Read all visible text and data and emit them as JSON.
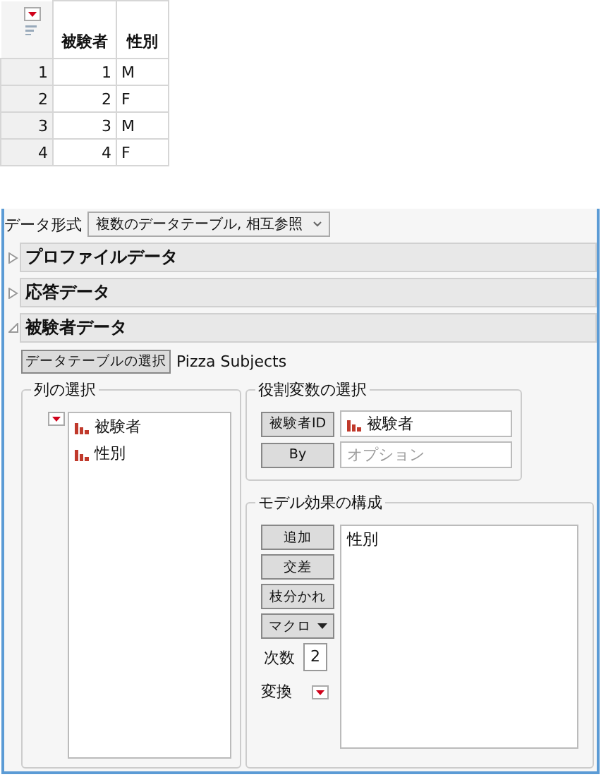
{
  "table": {
    "columns": [
      "被験者",
      "性別"
    ],
    "rows": [
      {
        "row": "1",
        "cells": [
          "1",
          "M"
        ]
      },
      {
        "row": "2",
        "cells": [
          "2",
          "F"
        ]
      },
      {
        "row": "3",
        "cells": [
          "3",
          "M"
        ]
      },
      {
        "row": "4",
        "cells": [
          "4",
          "F"
        ]
      }
    ]
  },
  "launch": {
    "data_format": {
      "label": "データ形式",
      "value": "複数のデータテーブル, 相互参照"
    },
    "sections": [
      {
        "title": "プロファイルデータ",
        "expanded": false
      },
      {
        "title": "応答データ",
        "expanded": false
      },
      {
        "title": "被験者データ",
        "expanded": true
      }
    ],
    "select_table": {
      "button": "データテーブルの選択",
      "value": "Pizza Subjects"
    },
    "column_select": {
      "title": "列の選択",
      "columns": [
        "被験者",
        "性別"
      ]
    },
    "roles": {
      "title": "役割変数の選択",
      "items": [
        {
          "button": "被験者ID",
          "value": "被験者"
        },
        {
          "button": "By",
          "placeholder": "オプション"
        }
      ]
    },
    "model": {
      "title": "モデル効果の構成",
      "buttons": [
        "追加",
        "交差",
        "枝分かれ",
        "マクロ"
      ],
      "degree_label": "次数",
      "degree": "2",
      "transform_label": "変換",
      "effects": [
        "性別"
      ]
    }
  }
}
